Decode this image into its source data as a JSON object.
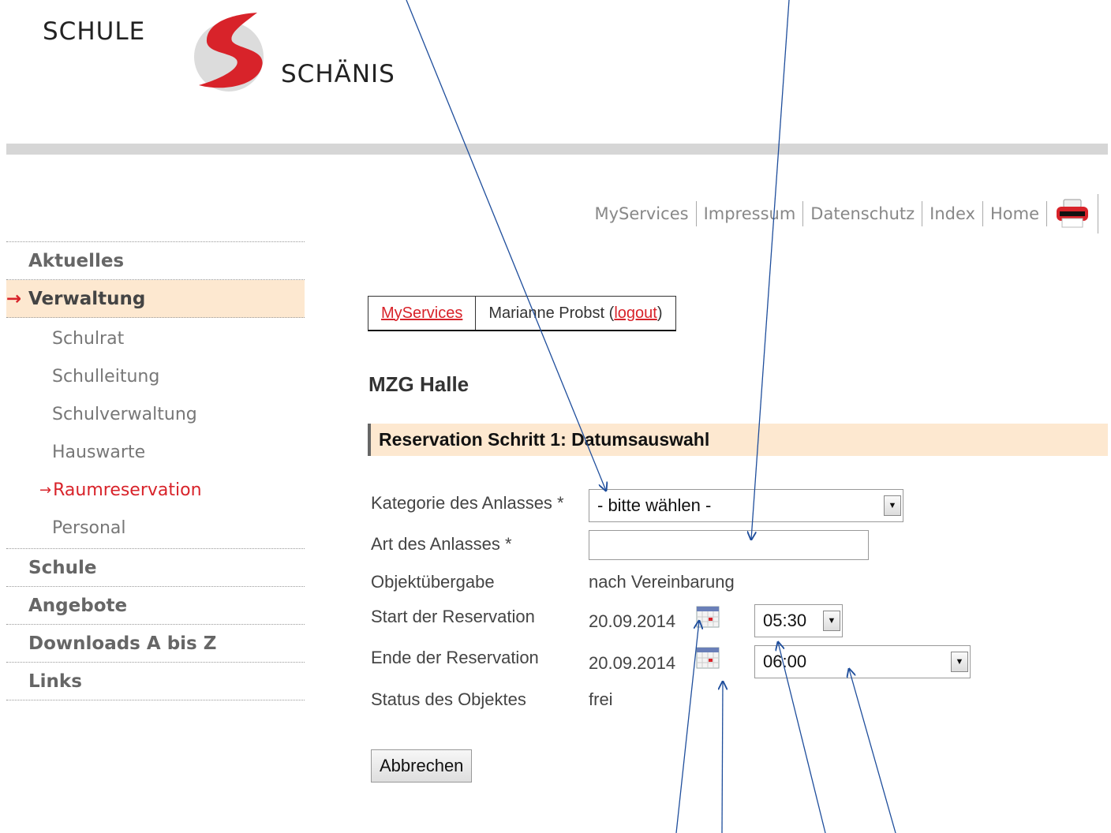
{
  "logo": {
    "word1": "SCHULE",
    "word2": "SCHÄNIS"
  },
  "toplinks": [
    "MyServices",
    "Impressum",
    "Datenschutz",
    "Index",
    "Home"
  ],
  "sidebar": {
    "items": [
      {
        "label": "Aktuelles"
      },
      {
        "label": "Verwaltung",
        "active": true
      },
      {
        "label": "Schule"
      },
      {
        "label": "Angebote"
      },
      {
        "label": "Downloads A bis Z"
      },
      {
        "label": "Links"
      }
    ],
    "subitems": [
      {
        "label": "Schulrat"
      },
      {
        "label": "Schulleitung"
      },
      {
        "label": "Schulverwaltung"
      },
      {
        "label": "Hauswarte"
      },
      {
        "label": "Raumreservation",
        "active": true
      },
      {
        "label": "Personal"
      }
    ],
    "active_arrow": "→"
  },
  "servicebar": {
    "myservices": "MyServices",
    "user_name": "Marianne Probst (",
    "logout": "logout",
    "close_paren": ")"
  },
  "page": {
    "title": "MZG Halle",
    "step_title": "Reservation Schritt 1: Datumsauswahl"
  },
  "form": {
    "kategorie_label": "Kategorie des Anlasses *",
    "kategorie_value": "- bitte wählen -",
    "art_label": "Art des Anlasses *",
    "art_value": "",
    "objekt_label": "Objektübergabe",
    "objekt_value": "nach Vereinbarung",
    "start_label": "Start der Reservation",
    "start_date": "20.09.2014",
    "start_time": "05:30",
    "ende_label": "Ende der Reservation",
    "ende_date": "20.09.2014",
    "ende_time": "06:00",
    "status_label": "Status des Objektes",
    "status_value": "frei",
    "cancel_label": "Abbrechen"
  },
  "colors": {
    "brand_red": "#d8232a",
    "highlight": "#fde8d0",
    "annotation_arrow": "#1f4e9c"
  }
}
